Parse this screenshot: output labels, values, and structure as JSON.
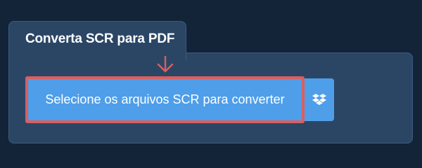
{
  "tab": {
    "title": "Converta SCR para PDF"
  },
  "upload": {
    "button_label": "Selecione os arquivos SCR para converter"
  },
  "dropbox": {
    "icon": "dropbox-icon"
  },
  "indicator": {
    "icon": "arrow-down-icon"
  },
  "colors": {
    "background": "#132438",
    "panel": "#2b4665",
    "button": "#4f9ee9",
    "highlight": "#d95f5f",
    "text": "#ffffff"
  }
}
